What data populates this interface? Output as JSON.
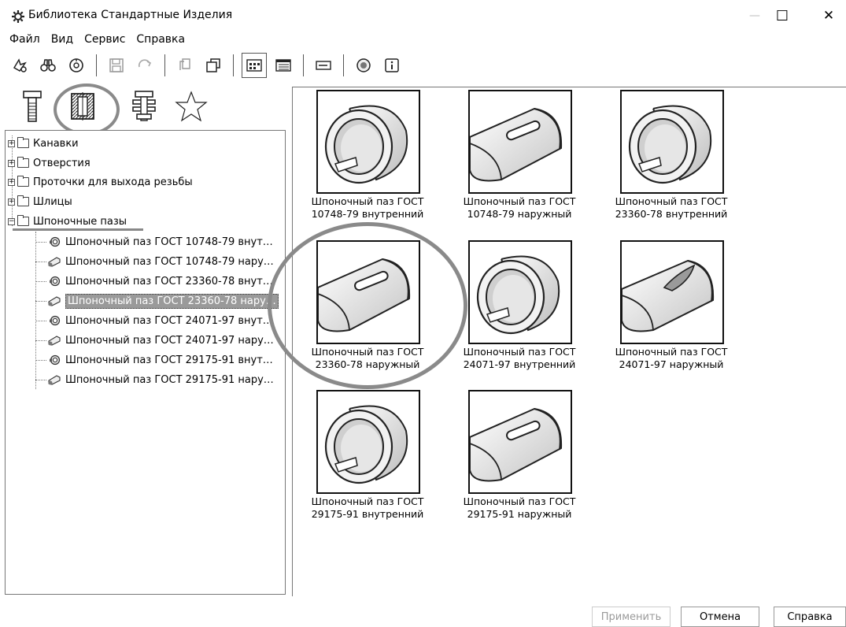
{
  "window": {
    "title": "Библиотека Стандартные Изделия",
    "minimize_glyph": "—",
    "maximize_glyph": "☐",
    "close_glyph": "✕"
  },
  "menu": [
    "Файл",
    "Вид",
    "Сервис",
    "Справка"
  ],
  "toolbar": {
    "icons": [
      "settings-icon",
      "binoculars-icon",
      "history-icon",
      "save-icon",
      "rotate-icon",
      "copy-icon",
      "window-icon",
      "large-icons-view-icon",
      "details-view-icon",
      "list-view-icon",
      "help-icon",
      "info-icon"
    ],
    "active": "large-icons-view-icon"
  },
  "category_tabs": {
    "items": [
      "bolt-icon",
      "hole-section-icon",
      "fastener-set-icon",
      "favorites-star-icon"
    ],
    "active": "hole-section-icon"
  },
  "tree": {
    "folders": [
      {
        "label": "Канавки",
        "expanded": false
      },
      {
        "label": "Отверстия",
        "expanded": false
      },
      {
        "label": "Проточки для выхода резьбы",
        "expanded": false
      },
      {
        "label": "Шлицы",
        "expanded": false
      },
      {
        "label": "Шпоночные пазы",
        "expanded": true
      }
    ],
    "expander_collapsed": "+",
    "expander_expanded": "−",
    "leaves": [
      "Шпоночный паз ГОСТ 10748-79 внут…",
      "Шпоночный паз ГОСТ 10748-79 нару…",
      "Шпоночный паз ГОСТ 23360-78 внут…",
      "Шпоночный паз ГОСТ 23360-78 нару…",
      "Шпоночный паз ГОСТ 24071-97 внут…",
      "Шпоночный паз ГОСТ 24071-97 нару…",
      "Шпоночный паз ГОСТ 29175-91 внут…",
      "Шпоночный паз ГОСТ 29175-91 нару…"
    ],
    "selected_index": 3
  },
  "gallery": {
    "items": [
      {
        "line1": "Шпоночный паз ГОСТ",
        "line2": "10748-79 внутренний",
        "kind": "inner"
      },
      {
        "line1": "Шпоночный паз ГОСТ",
        "line2": "10748-79 наружный",
        "kind": "outer"
      },
      {
        "line1": "Шпоночный паз ГОСТ",
        "line2": "23360-78 внутренний",
        "kind": "inner"
      },
      {
        "line1": "Шпоночный паз ГОСТ",
        "line2": "23360-78 наружный",
        "kind": "outer"
      },
      {
        "line1": "Шпоночный паз ГОСТ",
        "line2": "24071-97 внутренний",
        "kind": "inner"
      },
      {
        "line1": "Шпоночный паз ГОСТ",
        "line2": "24071-97 наружный",
        "kind": "outer2"
      },
      {
        "line1": "Шпоночный паз ГОСТ",
        "line2": "29175-91 внутренний",
        "kind": "inner"
      },
      {
        "line1": "Шпоночный паз ГОСТ",
        "line2": "29175-91 наружный",
        "kind": "outer"
      }
    ]
  },
  "buttons": {
    "apply": "Применить",
    "cancel": "Отмена",
    "help": "Справка",
    "apply_enabled": false
  },
  "annotations": {
    "ring_color": "#8a8a8a"
  }
}
